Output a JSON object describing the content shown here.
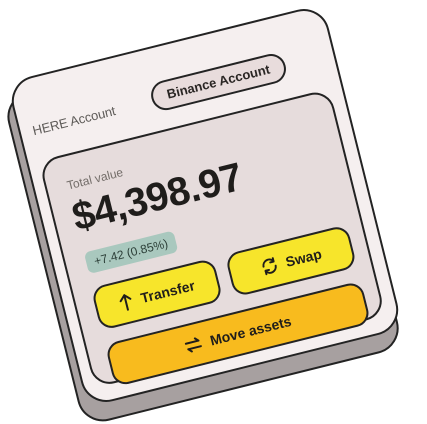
{
  "tabs": [
    {
      "label": "HERE Account",
      "active": false
    },
    {
      "label": "Binance Account",
      "active": true
    }
  ],
  "balance": {
    "label": "Total value",
    "value": "$4,398.97",
    "change": "+7.42 (0.85%)"
  },
  "actions": {
    "transfer": {
      "label": "Transfer",
      "icon": "arrow-up-icon"
    },
    "swap": {
      "label": "Swap",
      "icon": "swap-refresh-icon"
    },
    "move": {
      "label": "Move assets",
      "icon": "exchange-icon"
    }
  },
  "colors": {
    "card_bg": "#f5efef",
    "panel_bg": "#e6dcdc",
    "button_yellow": "#f7e52b",
    "button_amber": "#f8bb1e",
    "badge_green": "#a9c8be",
    "outline": "#232323"
  }
}
